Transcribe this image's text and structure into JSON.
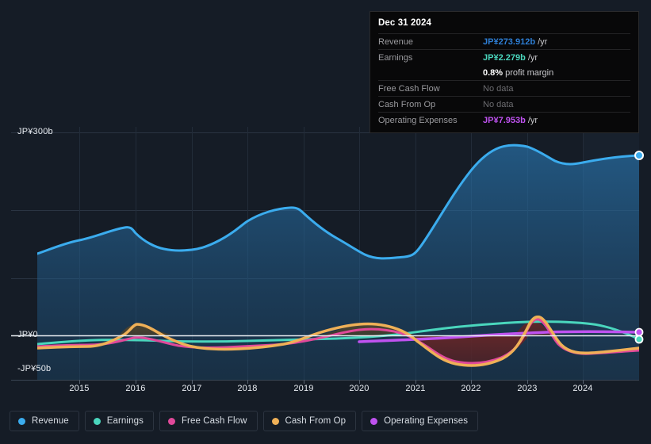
{
  "colors": {
    "background": "#151c26",
    "revenue": "#3bacee",
    "earnings": "#4ad6bd",
    "free_cash_flow": "#e0499a",
    "cash_from_op": "#efb057",
    "operating_expenses": "#bf52f0",
    "zero_line": "#e8ecf1",
    "grid": "#2a3442",
    "tooltip_bg": "#080809",
    "tooltip_label": "#9a9a9e",
    "tooltip_nodata": "#6c6c70",
    "revenue_tooltip": "#2e7fd6",
    "earnings_tooltip": "#4ad6bd",
    "opex_tooltip": "#bf52f0"
  },
  "tooltip": {
    "date": "Dec 31 2024",
    "rows": [
      {
        "label": "Revenue",
        "value": "JP¥273.912b",
        "suffix": "/yr",
        "color_key": "revenue_tooltip",
        "no_data": false
      },
      {
        "label": "Earnings",
        "value": "JP¥2.279b",
        "suffix": "/yr",
        "color_key": "earnings_tooltip",
        "no_data": false
      },
      {
        "label": "",
        "value": "0.8%",
        "suffix": "profit margin",
        "color_key": "margin",
        "no_data": false
      },
      {
        "label": "Free Cash Flow",
        "value": "No data",
        "suffix": "",
        "color_key": "nodata",
        "no_data": true
      },
      {
        "label": "Cash From Op",
        "value": "No data",
        "suffix": "",
        "color_key": "nodata",
        "no_data": true
      },
      {
        "label": "Operating Expenses",
        "value": "JP¥7.953b",
        "suffix": "/yr",
        "color_key": "opex_tooltip",
        "no_data": false
      }
    ]
  },
  "legend": {
    "items": [
      {
        "label": "Revenue",
        "color": "#3bacee"
      },
      {
        "label": "Earnings",
        "color": "#4ad6bd"
      },
      {
        "label": "Free Cash Flow",
        "color": "#e0499a"
      },
      {
        "label": "Cash From Op",
        "color": "#efb057"
      },
      {
        "label": "Operating Expenses",
        "color": "#bf52f0"
      }
    ]
  },
  "axes": {
    "y_top_label": "JP¥300b",
    "y_zero_label": "JP¥0",
    "y_bottom_label": "-JP¥50b",
    "x_ticks": [
      "2015",
      "2016",
      "2017",
      "2018",
      "2019",
      "2020",
      "2021",
      "2022",
      "2023",
      "2024"
    ]
  },
  "chart_data": {
    "type": "area",
    "title": "",
    "xlabel": "",
    "ylabel": "JP¥ (billions)",
    "currency": "JP¥",
    "unit": "b",
    "ylim": [
      -50,
      300
    ],
    "y_ticks": [
      300,
      0,
      -50
    ],
    "grid": true,
    "legend_position": "bottom",
    "x": [
      "2014",
      "2015",
      "2016",
      "2017",
      "2018",
      "2019",
      "2020",
      "2021",
      "2022",
      "2023",
      "2024"
    ],
    "x_tick_labels": [
      "2015",
      "2016",
      "2017",
      "2018",
      "2019",
      "2020",
      "2021",
      "2022",
      "2023",
      "2024"
    ],
    "series": [
      {
        "name": "Revenue",
        "color": "#3bacee",
        "filled": true,
        "values": [
          112,
          132,
          162,
          142,
          152,
          192,
          178,
          116,
          200,
          288,
          273.912
        ]
      },
      {
        "name": "Earnings",
        "color": "#4ad6bd",
        "filled": false,
        "values": [
          3,
          5,
          6,
          5,
          6,
          7,
          7,
          9,
          13,
          11,
          2.279
        ]
      },
      {
        "name": "Free Cash Flow",
        "color": "#e0499a",
        "filled": false,
        "values": [
          -4,
          -3,
          7,
          -2,
          -4,
          9,
          13,
          1,
          -30,
          17,
          -5
        ]
      },
      {
        "name": "Cash From Op",
        "color": "#efb057",
        "filled": false,
        "values": [
          -5,
          -2,
          10,
          -1,
          -3,
          11,
          14,
          2,
          -28,
          22,
          -3
        ]
      },
      {
        "name": "Operating Expenses",
        "color": "#bf52f0",
        "filled": false,
        "values": [
          null,
          null,
          null,
          null,
          null,
          null,
          3,
          4,
          5,
          6,
          7.953
        ]
      }
    ],
    "end_point_markers": true,
    "forecast_band_start": "2023.5"
  }
}
